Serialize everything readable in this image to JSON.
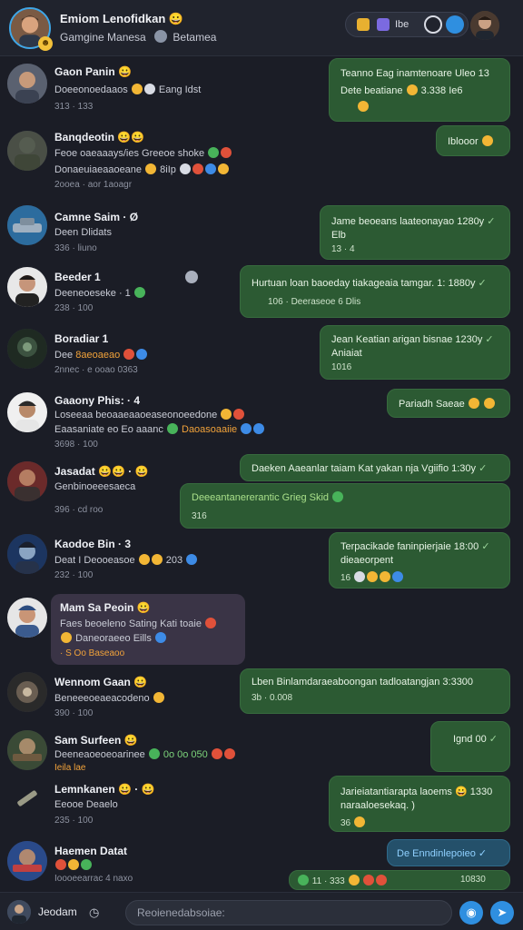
{
  "header": {
    "title": "Emiom Lenofidkan 😀",
    "subtitle_left": "Gamgine Manesa",
    "subtitle_right": "Betamea",
    "pill_label": "Ibe"
  },
  "messages": [
    {
      "name": "Gaon Panin 😀",
      "line1": "Doeeonoedaaos",
      "line1b": "Eang Idst",
      "meta": "313 · 133",
      "out": {
        "text1": "Teanno Eag inamtenoare Uleo 13",
        "text2": "Dete beatiane",
        "text2b": "3.338 Ie6",
        "meta": ""
      }
    },
    {
      "name": "Banqdeotin 😀😀",
      "line1": "Feoe oaeaaays/ies Greeoe shoke",
      "line2": "Donaeuiaeaaoeane",
      "line2b": "8iIp",
      "meta": "2ooea · aor 1aoagr",
      "out": {
        "text1": "Iblooor",
        "meta": ""
      }
    },
    {
      "name": "Camne Saim · Ø",
      "line1": "Deen Dlidats",
      "meta": "336 · liuno",
      "out": {
        "text1": "Jame beoeans laateonayao 1280y",
        "text2": "Elb",
        "meta": "13 · 4"
      }
    },
    {
      "name": "Beeder 1",
      "line1": "Deeneoeseke · 1",
      "meta": "238 · 100",
      "out": {
        "text1": "Hurtuan loan baoeday tiakageaia tamgar. 1: 1880y",
        "meta": "106 · Deeraseoe 6 Dlis"
      }
    },
    {
      "name": "Boradiar 1",
      "line1": "Dee",
      "line1b": "8aeoaeao",
      "meta": "2nnec · e ooao 0363",
      "out": {
        "text1": "Jean Keatian arigan bisnae 1230y",
        "text2": "Aniaiat",
        "meta": "1016"
      }
    },
    {
      "name": "Gaaony Phis: · 4",
      "line1": "Loseeaa beoaaeaaoeaseonoeedone",
      "line2": "Eaasaniate eo Eo aaanc",
      "line2b": "Daoasoaaiie",
      "meta": "3698 · 100",
      "out": {
        "text1": "Pariadh Saeae",
        "meta": ""
      }
    },
    {
      "name": "Jasadat 😀😀 · 😀",
      "line1": "Genbinoeeesaeca",
      "meta": "396 · cd roo",
      "out": {
        "text1": "Daeken Aaeanlar taiam Kat yakan nja Vgiifio 1:30y",
        "text2": "Deeeantanererantic Grieg Skid",
        "meta": "316"
      }
    },
    {
      "name": "Kaodoe Bin · 3",
      "line1": "Deat I Deooeasoe",
      "line1b": "203",
      "meta": "232 · 100",
      "out": {
        "text1": "Terpacikade faninpierjaie 18:00",
        "text2": "dieaeorpent",
        "meta": "16"
      }
    },
    {
      "name": "Mam Sa Peoin 😀",
      "line1": "Faes beoeleno Sating Kati toaie",
      "line2": "Daneoraeeo",
      "line2b": "Eills",
      "meta": "· S Oo Baseaoo",
      "out": null
    },
    {
      "name": "Wennom Gaan 😀",
      "line1": "Beneeeoeaeacodeno",
      "meta": "390 · 100",
      "out": {
        "text1": "Lben Binlamdaraeaboongan tadloatangjan 3:3300",
        "meta": "3b · 0.008"
      }
    },
    {
      "name": "Sam Surfeen 😀",
      "line1": "Deeneaoeoeoarinee",
      "line1b": "0o 0o 050",
      "line2": "Ieila lae",
      "meta": "",
      "out": {
        "text1": "Ignd 00",
        "meta": ""
      }
    },
    {
      "name": "Lemnkanen 😀 · 😀",
      "line1": "Eeooe Deaelo",
      "meta": "235 · 100",
      "out": {
        "text1": "Jarieiatantiarapta laoems 😀 1330",
        "text2": "naraaloesekaq. )",
        "meta": "36"
      }
    },
    {
      "name": "Haemen Datat",
      "line1": "Ioooeearrac",
      "line1b": "4 naxo",
      "meta": "",
      "out": {
        "text1": "De Enndinlepoieo",
        "meta": "11 · 333",
        "meta2": "10830"
      }
    }
  ],
  "composer": {
    "name": "Jeodam",
    "placeholder": "Reoienedabsoiae:"
  },
  "colors": {
    "background": "#1b1d26",
    "out_bubble": "#2c5a33",
    "in_bubble": "#3a3446",
    "accent": "#2f8fe0"
  }
}
